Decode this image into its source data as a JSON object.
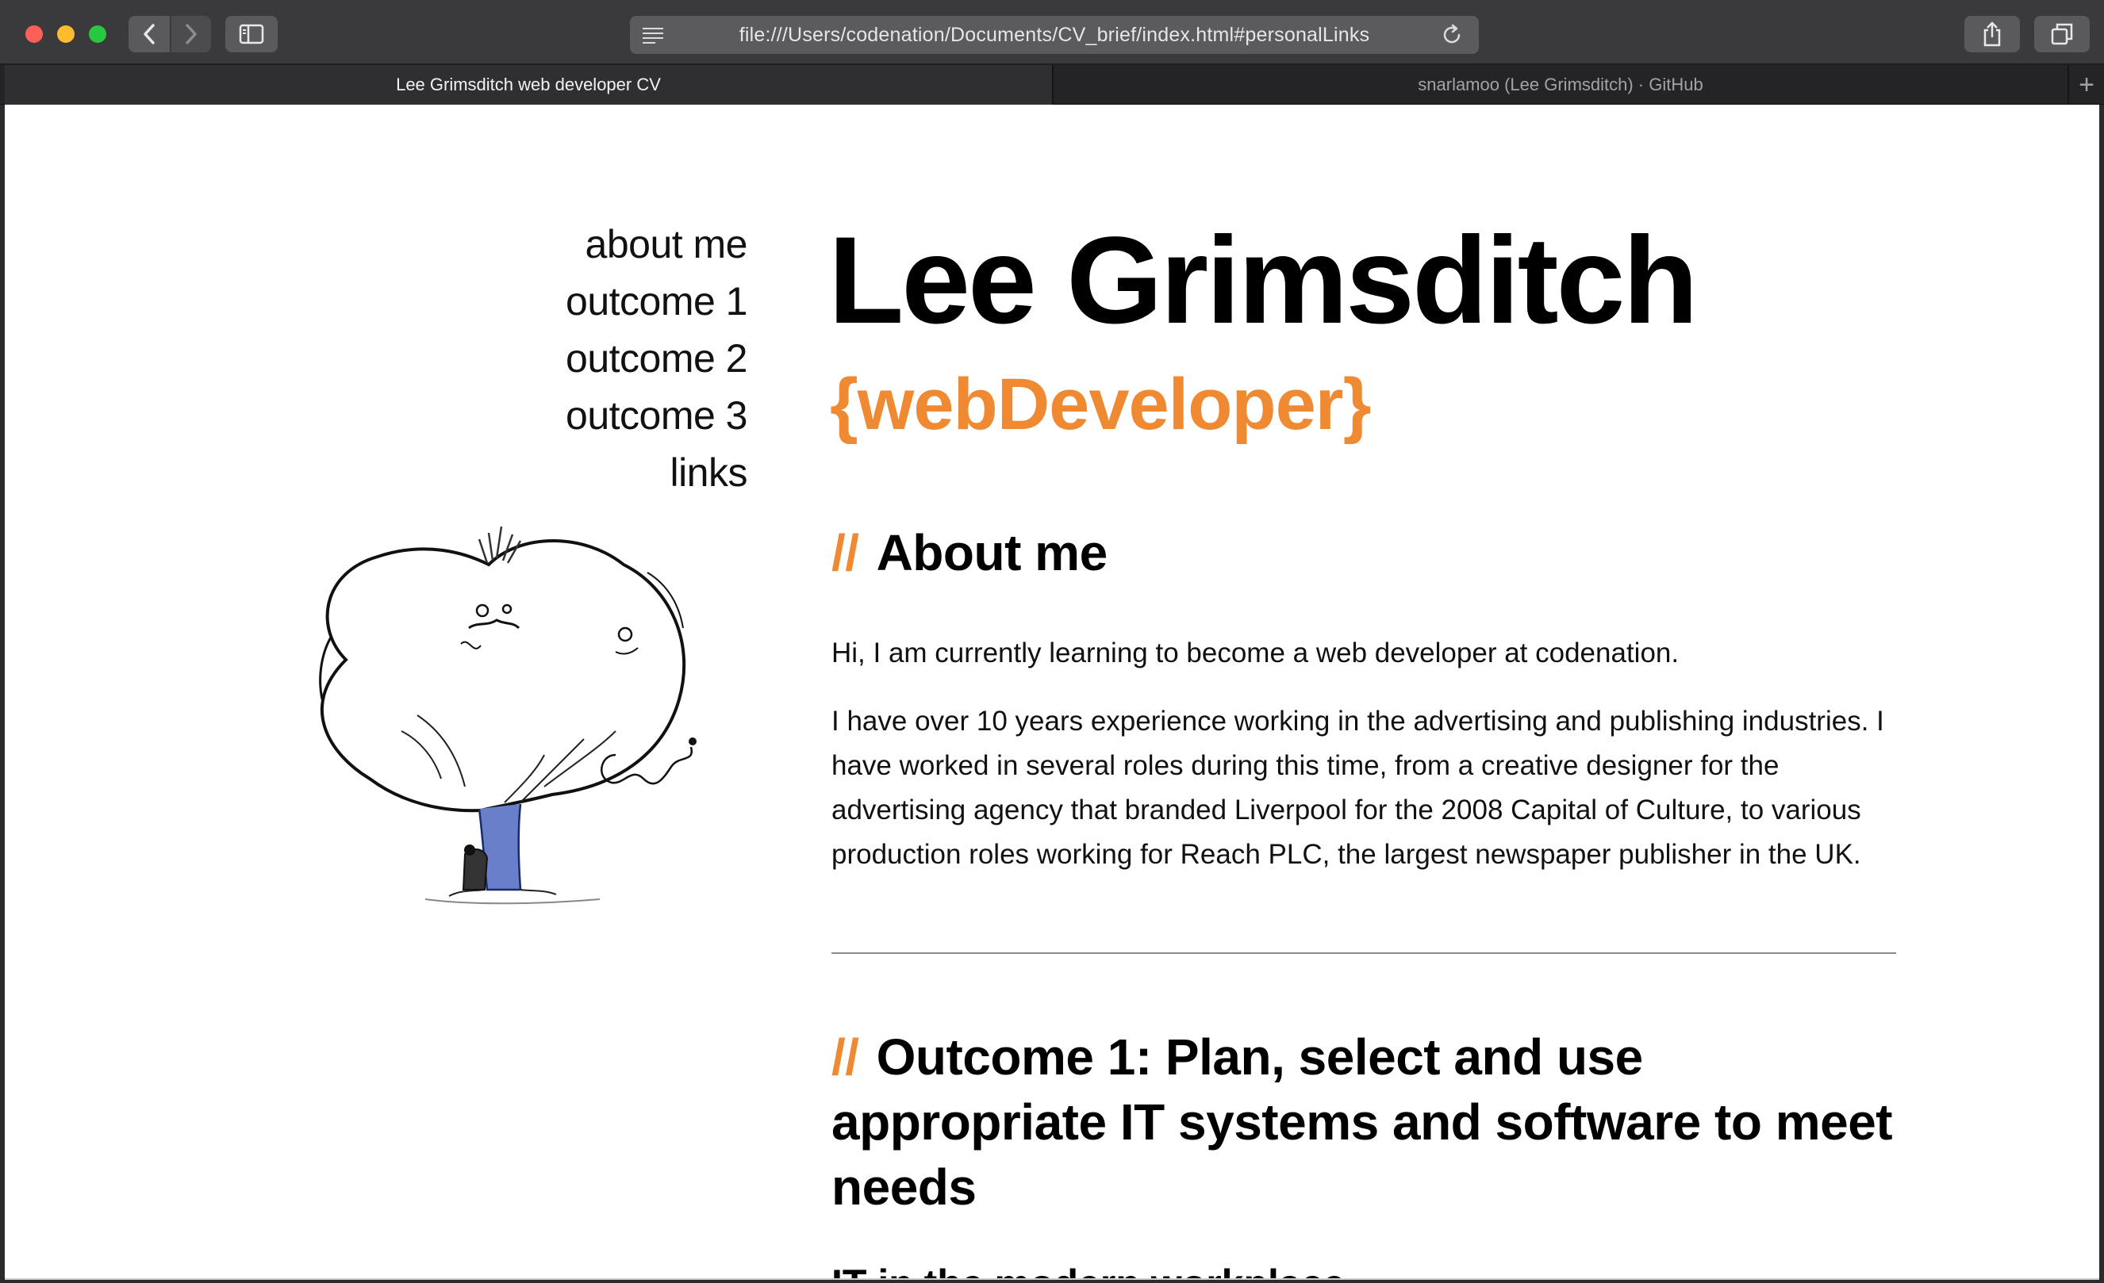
{
  "browser": {
    "url": "file:///Users/codenation/Documents/CV_brief/index.html#personalLinks",
    "tabs": [
      {
        "label": "Lee Grimsditch web developer CV"
      },
      {
        "label": "snarlamoo (Lee Grimsditch) · GitHub"
      }
    ],
    "new_tab_label": "+",
    "icons": {
      "back": "chevron-left-icon",
      "forward": "chevron-right-icon",
      "sidebar": "sidebar-icon",
      "reader": "reader-icon",
      "reload": "reload-icon",
      "share": "share-icon",
      "tabs": "tabs-overview-icon"
    }
  },
  "nav": {
    "items": [
      {
        "label": "about me"
      },
      {
        "label": "outcome 1"
      },
      {
        "label": "outcome 2"
      },
      {
        "label": "outcome 3"
      },
      {
        "label": "links"
      }
    ]
  },
  "header": {
    "name": "Lee Grimsditch",
    "job_title": "{webDeveloper}"
  },
  "about": {
    "slashes": "//",
    "heading": "About me",
    "p1": "Hi, I am currently learning to become a web developer at codenation.",
    "p2": "I have over 10 years experience working in the advertising and publishing industries. I have worked in several roles during this time, from a creative designer for the advertising agency that branded Liverpool for the 2008 Capital of Culture, to various production roles working for Reach PLC, the largest newspaper publisher in the UK."
  },
  "outcome1": {
    "slashes": "//",
    "heading": "Outcome 1: Plan, select and use appropriate IT systems and software to meet needs",
    "subheading": "IT in the modern workplace"
  },
  "colors": {
    "accent": "#ef8a33",
    "text": "#000000",
    "toolbar": "#3a3a3c"
  }
}
